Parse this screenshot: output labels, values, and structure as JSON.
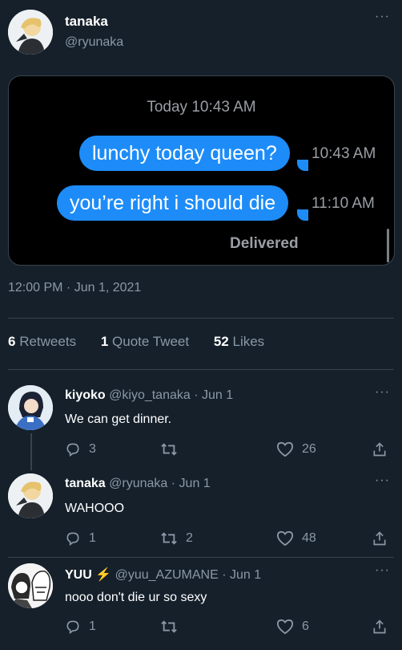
{
  "tweet": {
    "author_name": "tanaka",
    "author_handle": "@ryunaka",
    "more": "···",
    "timestamp": "12:00 PM · Jun 1, 2021",
    "stats": {
      "retweets_count": "6",
      "retweets_label": "Retweets",
      "quotes_count": "1",
      "quotes_label": "Quote Tweet",
      "likes_count": "52",
      "likes_label": "Likes"
    }
  },
  "screenshot": {
    "date_header": "Today 10:43 AM",
    "messages": [
      {
        "text": "lunchy today queen?",
        "time": "10:43 AM"
      },
      {
        "text": "you’re right i should die",
        "time": "11:10 AM"
      }
    ],
    "status": "Delivered"
  },
  "replies": [
    {
      "name": "kiyoko",
      "handle_date": "@kiyo_tanaka · Jun 1",
      "text": "We can get dinner.",
      "reply_count": "3",
      "retweet_count": "",
      "like_count": "26"
    },
    {
      "name": "tanaka",
      "handle_date": "@ryunaka · Jun 1",
      "text": "WAHOOO",
      "reply_count": "1",
      "retweet_count": "2",
      "like_count": "48"
    },
    {
      "name": "YUU",
      "name_emoji": "⚡",
      "handle_date": "@yuu_AZUMANE · Jun 1",
      "text": "nooo don't die ur so sexy",
      "reply_count": "1",
      "retweet_count": "",
      "like_count": "6"
    }
  ],
  "colors": {
    "background": "#15202b",
    "muted": "#8b98a5",
    "imessage_blue": "#1d8cf8",
    "divider": "#38444d",
    "lightning": "#ffcc00"
  }
}
